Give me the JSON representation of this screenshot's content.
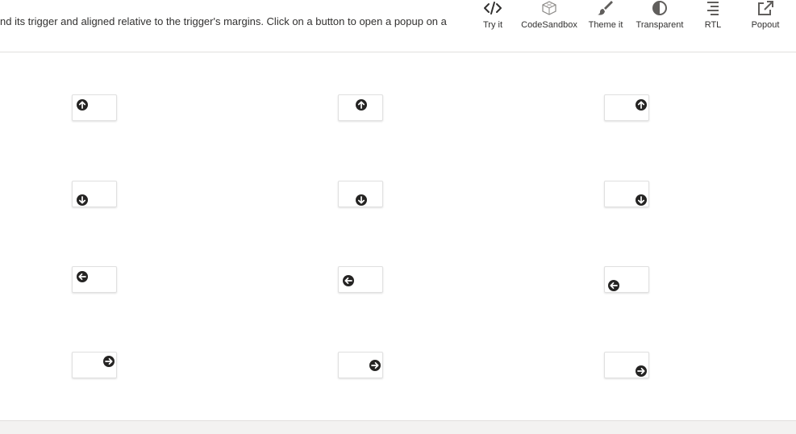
{
  "header": {
    "description": "nd its trigger and aligned relative to the trigger's margins. Click on a button to open a popup on a"
  },
  "toolbar": {
    "items": [
      {
        "label": "Try it",
        "icon": "code-icon"
      },
      {
        "label": "CodeSandbox",
        "icon": "codesandbox-icon"
      },
      {
        "label": "Theme it",
        "icon": "brush-icon"
      },
      {
        "label": "Transparent",
        "icon": "contrast-icon"
      },
      {
        "label": "RTL",
        "icon": "rtl-icon"
      },
      {
        "label": "Popout",
        "icon": "popout-icon"
      }
    ]
  },
  "popup_buttons": [
    {
      "position": "above-start",
      "icon": "arrow-up-icon"
    },
    {
      "position": "above",
      "icon": "arrow-up-icon"
    },
    {
      "position": "above-end",
      "icon": "arrow-up-icon"
    },
    {
      "position": "below-start",
      "icon": "arrow-down-icon"
    },
    {
      "position": "below",
      "icon": "arrow-down-icon"
    },
    {
      "position": "below-end",
      "icon": "arrow-down-icon"
    },
    {
      "position": "before-top",
      "icon": "arrow-left-icon"
    },
    {
      "position": "before",
      "icon": "arrow-left-icon"
    },
    {
      "position": "before-bottom",
      "icon": "arrow-left-icon"
    },
    {
      "position": "after-top",
      "icon": "arrow-right-icon"
    },
    {
      "position": "after",
      "icon": "arrow-right-icon"
    },
    {
      "position": "after-bottom",
      "icon": "arrow-right-icon"
    }
  ],
  "colors": {
    "icon": "#323130",
    "border": "#e0e0e0",
    "divider": "#e1dfdd"
  }
}
